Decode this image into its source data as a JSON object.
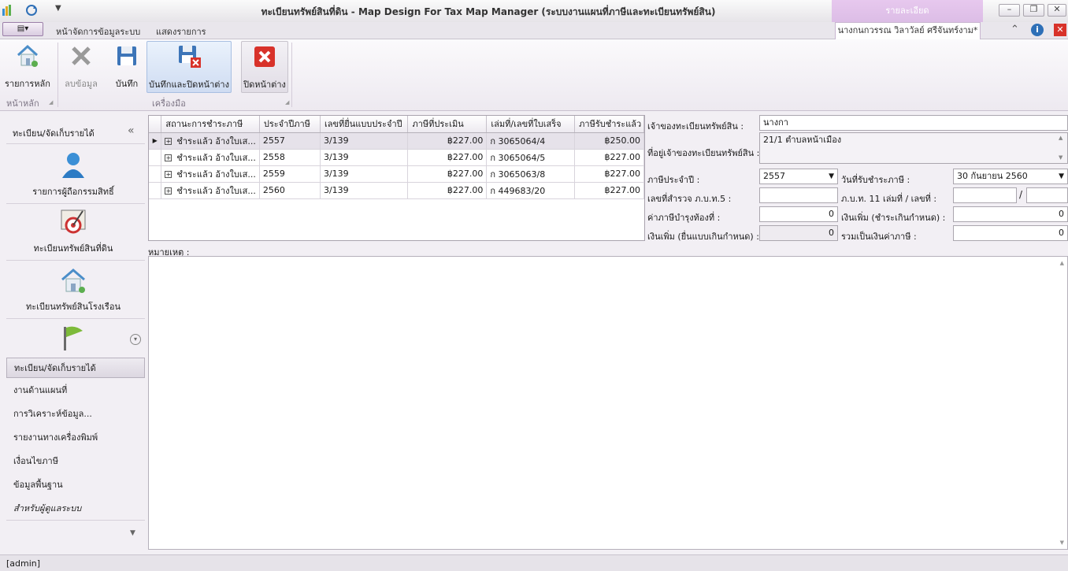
{
  "window": {
    "title": "ทะเบียนทรัพย์สินที่ดิน - Map Design For Tax Map Manager (ระบบงานแผนที่ภาษีและทะเบียนทรัพย์สิน)",
    "context_group": "รายละเอียด",
    "context_tab": "นางกนกวรรณ วิลาวัลย์ ศรีจันทร์งาม*"
  },
  "tabs": [
    "หน้าจัดการข้อมูลระบบ",
    "แสดงรายการ"
  ],
  "ribbon": {
    "main_group": "หน้าหลัก",
    "tools_group": "เครื่องมือ",
    "home_button": "รายการหลัก",
    "delete_button": "ลบข้อมูล",
    "save_button": "บันทึก",
    "save_close_button": "บันทึกและปิดหน้าต่าง",
    "close_button": "ปิดหน้าต่าง"
  },
  "sidebar": {
    "header": "ทะเบียน/จัดเก็บรายได้",
    "big_items": [
      "รายการผู้ถือกรรมสิทธิ์",
      "ทะเบียนทรัพย์สินที่ดิน",
      "ทะเบียนทรัพย์สินโรงเรือน"
    ],
    "nav_items": [
      "ทะเบียน/จัดเก็บรายได้",
      "งานด้านแผนที่",
      "การวิเคราะห์ข้อมูล...",
      "รายงานทางเครื่องพิมพ์",
      "เงื่อนไขภาษี",
      "ข้อมูลพื้นฐาน",
      "สำหรับผู้ดูแลระบบ"
    ]
  },
  "grid": {
    "columns": [
      "สถานะการชำระภาษี",
      "ประจำปีภาษี",
      "เลขที่ยื่นแบบประจำปี",
      "ภาษีที่ประเมิน",
      "เล่มที่/เลขที่ใบเสร็จ",
      "ภาษีรับชำระแล้ว"
    ],
    "rows": [
      [
        "ชำระแล้ว อ้างใบเส...",
        "2557",
        "3/139",
        "฿227.00",
        "ก 3065064/4",
        "฿250.00"
      ],
      [
        "ชำระแล้ว อ้างใบเส...",
        "2558",
        "3/139",
        "฿227.00",
        "ก 3065064/5",
        "฿227.00"
      ],
      [
        "ชำระแล้ว อ้างใบเส...",
        "2559",
        "3/139",
        "฿227.00",
        "ก 3065063/8",
        "฿227.00"
      ],
      [
        "ชำระแล้ว อ้างใบเส...",
        "2560",
        "3/139",
        "฿227.00",
        "ก 449683/20",
        "฿227.00"
      ]
    ]
  },
  "form": {
    "owner_label": "เจ้าของทะเบียนทรัพย์สิน :",
    "owner_value": "นางกา",
    "address_label": "ที่อยู่เจ้าของทะเบียนทรัพย์สิน :",
    "address_value": "21/1  ตำบลหน้าเมือง",
    "tax_year_label": "ภาษีประจำปี :",
    "tax_year_value": "2557",
    "pay_date_label": "วันที่รับชำระภาษี :",
    "pay_date_value": "30 กันยายน 2560",
    "survey_no_label": "เลขที่สำรวจ ภ.บ.ท.5 :",
    "survey_no_value": "",
    "pbt11_label": "ภ.บ.ท. 11 เล่มที่ / เลขที่ :",
    "pbt11_book": "",
    "pbt11_sep": "/",
    "pbt11_no": "",
    "local_tax_label": "ค่าภาษีบำรุงท้องที่ :",
    "local_tax_value": "0",
    "surcharge_late_pay_label": "เงินเพิ่ม (ชำระเกินกำหนด) :",
    "surcharge_late_pay_value": "0",
    "surcharge_late_file_label": "เงินเพิ่ม (ยื่นแบบเกินกำหนด) :",
    "surcharge_late_file_value": "0",
    "total_label": "รวมเป็นเงินค่าภาษี :",
    "total_value": "0",
    "memo_label": "หมายเหตุ :"
  },
  "status": "[admin]"
}
